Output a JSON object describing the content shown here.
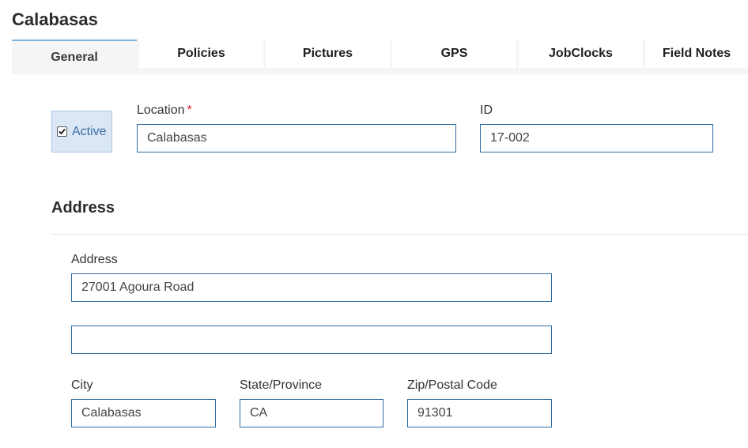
{
  "page": {
    "title": "Calabasas"
  },
  "tabs": [
    {
      "label": "General",
      "active": true
    },
    {
      "label": "Policies",
      "active": false
    },
    {
      "label": "Pictures",
      "active": false
    },
    {
      "label": "GPS",
      "active": false
    },
    {
      "label": "JobClocks",
      "active": false
    },
    {
      "label": "Field Notes",
      "active": false
    }
  ],
  "active_checkbox": {
    "label": "Active",
    "checked": true
  },
  "location": {
    "label": "Location",
    "required_mark": "*",
    "value": "Calabasas"
  },
  "id_field": {
    "label": "ID",
    "value": "17-002"
  },
  "address_section": {
    "title": "Address",
    "address_label": "Address",
    "line1": "27001 Agoura Road",
    "line2": "",
    "city_label": "City",
    "city": "Calabasas",
    "state_label": "State/Province",
    "state": "CA",
    "zip_label": "Zip/Postal Code",
    "zip": "91301"
  },
  "colors": {
    "accent": "#7fb3de",
    "input_border": "#2e6aa0",
    "checkbox_bg": "#dbe7f5",
    "required": "#d9242b"
  }
}
